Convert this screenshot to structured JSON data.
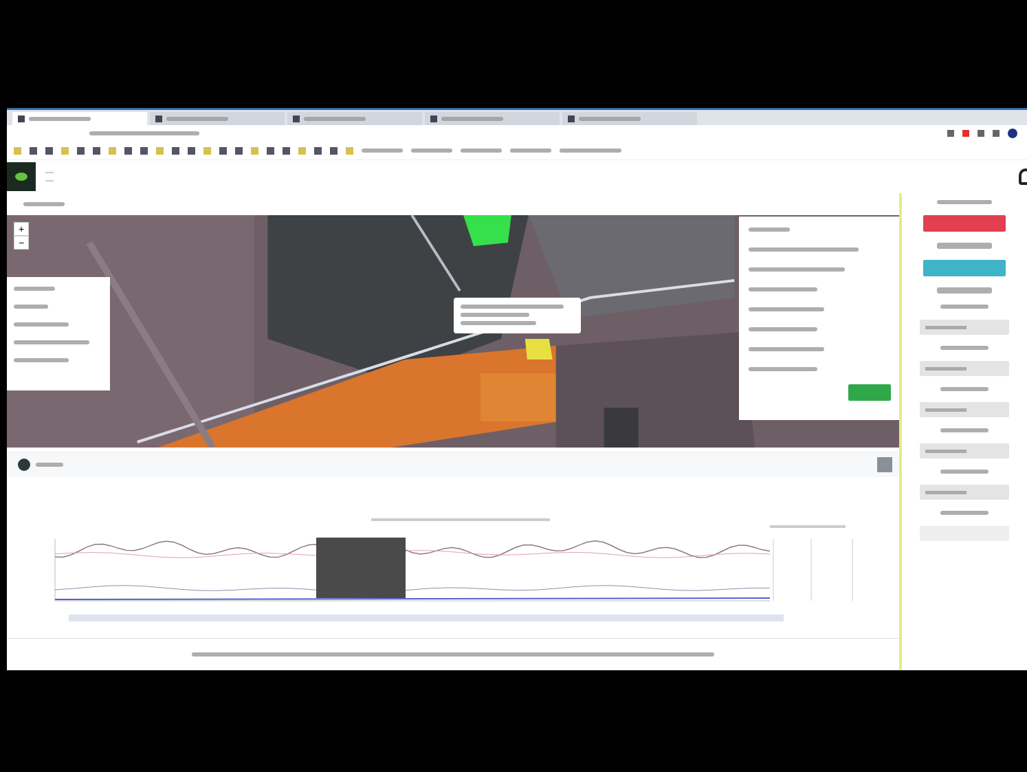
{
  "browser": {
    "tabs": [
      {
        "selected": true
      },
      {
        "selected": false
      },
      {
        "selected": false
      },
      {
        "selected": false
      },
      {
        "selected": false
      }
    ]
  },
  "map": {
    "zoom_controls": [
      "+",
      "−"
    ]
  },
  "side_panel": {
    "buttons": [
      {
        "color": "#e0404f"
      },
      {
        "color": "#3fb4c8"
      }
    ],
    "fields": [
      {
        "filled": true
      },
      {
        "filled": true
      },
      {
        "filled": true
      },
      {
        "filled": true
      },
      {
        "filled": true
      },
      {
        "filled": false
      }
    ]
  }
}
